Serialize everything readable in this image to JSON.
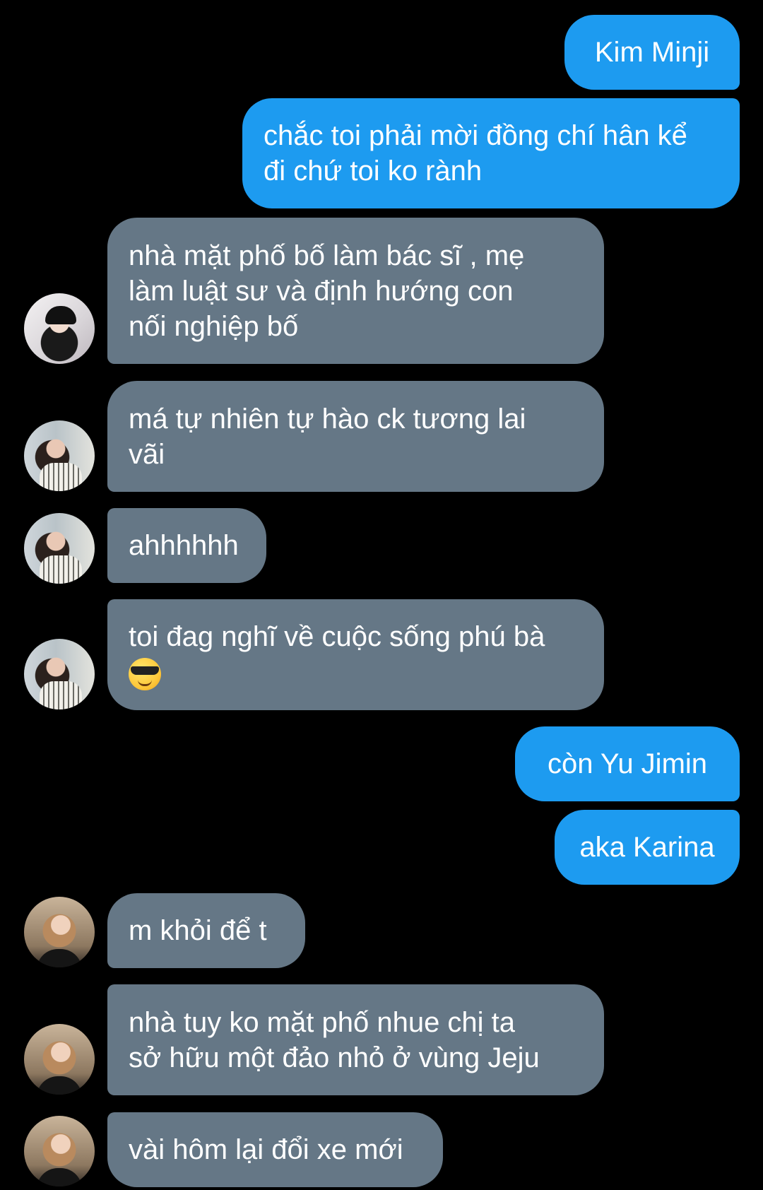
{
  "conversation": {
    "messages": [
      {
        "direction": "outgoing",
        "lines": [
          "Kim Minji"
        ]
      },
      {
        "direction": "outgoing",
        "lines": [
          "chắc toi phải mời đồng chí hân kể",
          "đi chứ toi ko rành"
        ]
      },
      {
        "direction": "incoming",
        "avatar": "avatar-minji",
        "lines": [
          "nhà mặt phố bố làm bác sĩ , mẹ",
          "làm luật sư và định hướng con",
          "nối nghiệp bố"
        ]
      },
      {
        "direction": "incoming",
        "avatar": "avatar-girl-striped",
        "lines": [
          "má tự nhiên tự hào ck tương lai",
          "vãi"
        ]
      },
      {
        "direction": "incoming",
        "avatar": "avatar-girl-striped",
        "lines": [
          "ahhhhhh"
        ]
      },
      {
        "direction": "incoming",
        "avatar": "avatar-girl-striped",
        "lines": [
          "toi đag nghĩ về cuộc sống phú bà"
        ],
        "emoji": "smiling-face-with-sunglasses"
      },
      {
        "direction": "outgoing",
        "lines": [
          "còn Yu Jimin"
        ]
      },
      {
        "direction": "outgoing",
        "lines": [
          "aka Karina"
        ]
      },
      {
        "direction": "incoming",
        "avatar": "avatar-girl-blonde",
        "lines": [
          "m khỏi để t"
        ]
      },
      {
        "direction": "incoming",
        "avatar": "avatar-girl-blonde",
        "lines": [
          "nhà tuy ko mặt phố nhue chị ta",
          "sở hữu một đảo nhỏ ở vùng Jeju"
        ]
      },
      {
        "direction": "incoming",
        "avatar": "avatar-girl-blonde",
        "lines": [
          "vài hôm lại đổi xe mới"
        ]
      }
    ]
  },
  "colors": {
    "background": "#000000",
    "outgoing_bubble": "#1d9bf0",
    "incoming_bubble": "#657786",
    "text": "#ffffff"
  }
}
